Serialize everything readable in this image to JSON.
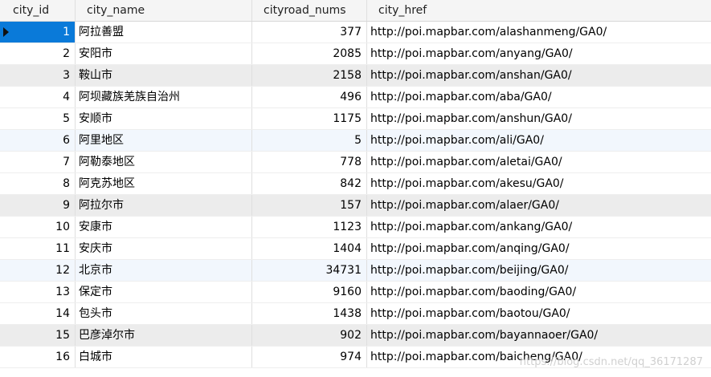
{
  "columns": {
    "city_id": "city_id",
    "city_name": "city_name",
    "cityroad_nums": "cityroad_nums",
    "city_href": "city_href"
  },
  "rows": [
    {
      "city_id": "1",
      "city_name": "阿拉善盟",
      "cityroad_nums": "377",
      "city_href": "http://poi.mapbar.com/alashanmeng/GA0/"
    },
    {
      "city_id": "2",
      "city_name": "安阳市",
      "cityroad_nums": "2085",
      "city_href": "http://poi.mapbar.com/anyang/GA0/"
    },
    {
      "city_id": "3",
      "city_name": "鞍山市",
      "cityroad_nums": "2158",
      "city_href": "http://poi.mapbar.com/anshan/GA0/"
    },
    {
      "city_id": "4",
      "city_name": "阿坝藏族羌族自治州",
      "cityroad_nums": "496",
      "city_href": "http://poi.mapbar.com/aba/GA0/"
    },
    {
      "city_id": "5",
      "city_name": "安顺市",
      "cityroad_nums": "1175",
      "city_href": "http://poi.mapbar.com/anshun/GA0/"
    },
    {
      "city_id": "6",
      "city_name": "阿里地区",
      "cityroad_nums": "5",
      "city_href": "http://poi.mapbar.com/ali/GA0/"
    },
    {
      "city_id": "7",
      "city_name": "阿勒泰地区",
      "cityroad_nums": "778",
      "city_href": "http://poi.mapbar.com/aletai/GA0/"
    },
    {
      "city_id": "8",
      "city_name": "阿克苏地区",
      "cityroad_nums": "842",
      "city_href": "http://poi.mapbar.com/akesu/GA0/"
    },
    {
      "city_id": "9",
      "city_name": "阿拉尔市",
      "cityroad_nums": "157",
      "city_href": "http://poi.mapbar.com/alaer/GA0/"
    },
    {
      "city_id": "10",
      "city_name": "安康市",
      "cityroad_nums": "1123",
      "city_href": "http://poi.mapbar.com/ankang/GA0/"
    },
    {
      "city_id": "11",
      "city_name": "安庆市",
      "cityroad_nums": "1404",
      "city_href": "http://poi.mapbar.com/anqing/GA0/"
    },
    {
      "city_id": "12",
      "city_name": "北京市",
      "cityroad_nums": "34731",
      "city_href": "http://poi.mapbar.com/beijing/GA0/"
    },
    {
      "city_id": "13",
      "city_name": "保定市",
      "cityroad_nums": "9160",
      "city_href": "http://poi.mapbar.com/baoding/GA0/"
    },
    {
      "city_id": "14",
      "city_name": "包头市",
      "cityroad_nums": "1438",
      "city_href": "http://poi.mapbar.com/baotou/GA0/"
    },
    {
      "city_id": "15",
      "city_name": "巴彦淖尔市",
      "cityroad_nums": "902",
      "city_href": "http://poi.mapbar.com/bayannaoer/GA0/"
    },
    {
      "city_id": "16",
      "city_name": "白城市",
      "cityroad_nums": "974",
      "city_href": "http://poi.mapbar.com/baicheng/GA0/"
    }
  ],
  "selection": {
    "row_index": 0,
    "column": "city_id",
    "indicator_icon": "row-pointer-icon"
  },
  "colors": {
    "selection_bg": "#0a7ad9",
    "alt_row_bg": "#ececec",
    "light_blue_row_bg": "#f2f7fd"
  },
  "watermark": "https://blog.csdn.net/qq_36171287"
}
